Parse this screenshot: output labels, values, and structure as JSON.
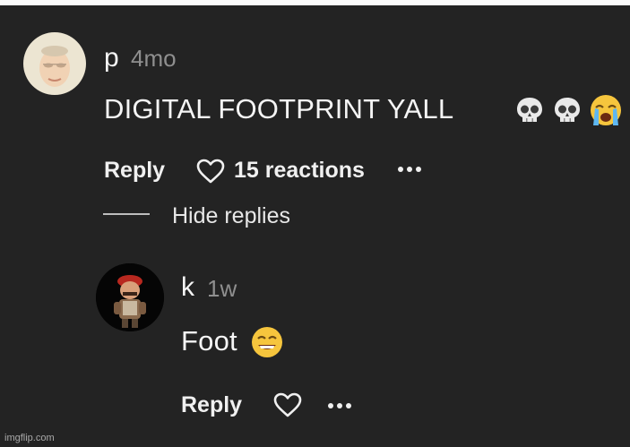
{
  "comment": {
    "username": "p",
    "timestamp": "4mo",
    "text": "DIGITAL FOOTPRINT YALL",
    "emojis": [
      "skull-emoji",
      "skull-emoji",
      "loudly-crying-face-emoji"
    ],
    "reply_label": "Reply",
    "reactions_label": "15 reactions",
    "hide_replies_label": "Hide replies"
  },
  "reply": {
    "username": "k",
    "timestamp": "1w",
    "text": "Foot",
    "emojis": [
      "grimacing-smile-emoji"
    ],
    "reply_label": "Reply"
  },
  "watermark": "imgflip.com",
  "colors": {
    "background": "#232323",
    "text": "#f5f5f5",
    "muted": "#8f8f8f"
  }
}
